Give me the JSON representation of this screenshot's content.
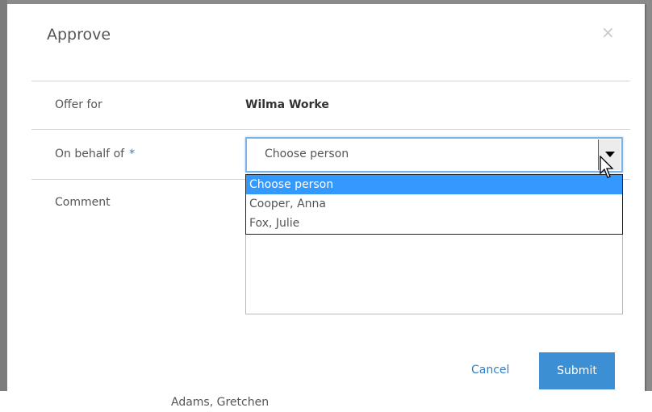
{
  "background": {
    "partial_text": "Adams, Gretchen"
  },
  "dialog": {
    "title": "Approve",
    "close_symbol": "×",
    "fields": {
      "offer_for": {
        "label": "Offer for",
        "value": "Wilma Worke"
      },
      "on_behalf_of": {
        "label": "On behalf of",
        "required_marker": "*",
        "selected": "Choose person",
        "options": [
          "Choose person",
          "Cooper, Anna",
          "Fox, Julie"
        ]
      },
      "comment": {
        "label": "Comment",
        "value": ""
      }
    },
    "buttons": {
      "cancel": "Cancel",
      "submit": "Submit"
    }
  },
  "colors": {
    "accent": "#3c8fd3",
    "link": "#2f7dc5",
    "highlight": "#3399ff"
  },
  "icons": [
    "close-icon",
    "chevron-down-icon",
    "mouse-cursor-icon"
  ]
}
